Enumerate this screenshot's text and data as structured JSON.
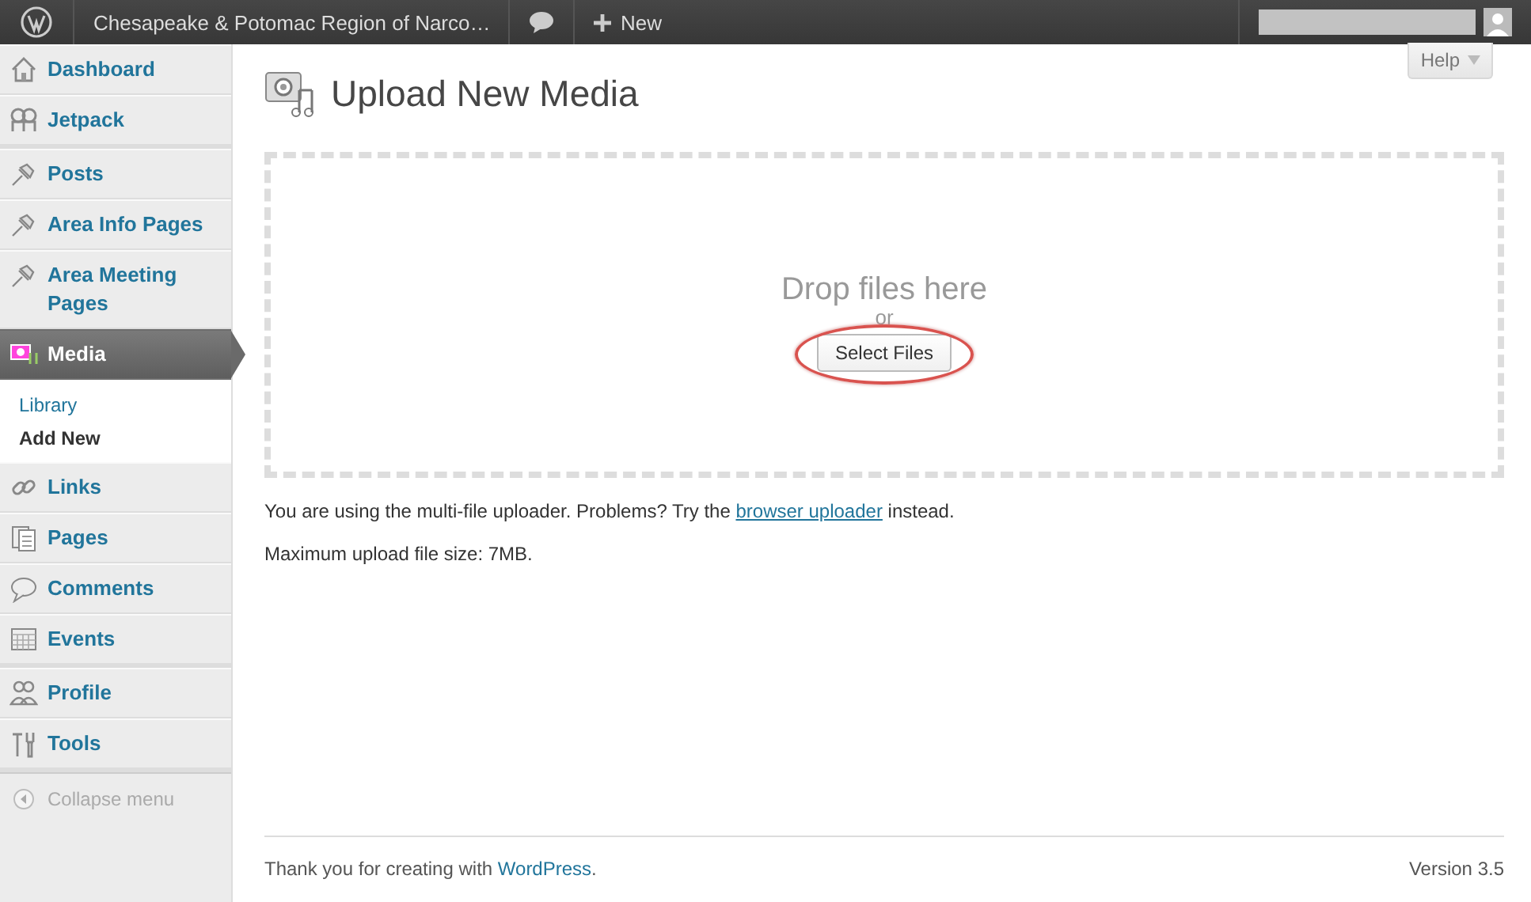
{
  "admin_bar": {
    "site_title": "Chesapeake & Potomac Region of Narco…",
    "new_label": "New"
  },
  "help_button": "Help",
  "sidebar": {
    "groups": [
      [
        {
          "label": "Dashboard",
          "selected": false
        },
        {
          "label": "Jetpack",
          "selected": false
        }
      ],
      [
        {
          "label": "Posts",
          "selected": false
        },
        {
          "label": "Area Info Pages",
          "selected": false
        },
        {
          "label": "Area Meeting Pages",
          "selected": false
        },
        {
          "label": "Media",
          "selected": true,
          "children": [
            {
              "label": "Library",
              "selected": false
            },
            {
              "label": "Add New",
              "selected": true
            }
          ]
        },
        {
          "label": "Links",
          "selected": false
        },
        {
          "label": "Pages",
          "selected": false
        },
        {
          "label": "Comments",
          "selected": false
        },
        {
          "label": "Events",
          "selected": false
        }
      ],
      [
        {
          "label": "Profile",
          "selected": false
        },
        {
          "label": "Tools",
          "selected": false
        }
      ]
    ],
    "collapse_label": "Collapse menu"
  },
  "page_title": "Upload New Media",
  "dropzone": {
    "heading": "Drop files here",
    "or": "or",
    "button": "Select Files",
    "button_circled": true
  },
  "notes": [
    {
      "before": "You are using the multi-file uploader. Problems? Try the ",
      "link": "browser uploader",
      "after": " instead."
    },
    {
      "before": "Maximum upload file size: 7MB."
    }
  ],
  "footer": {
    "before": "Thank you for creating with ",
    "link": "WordPress",
    "after": ".",
    "version": "Version 3.5"
  }
}
